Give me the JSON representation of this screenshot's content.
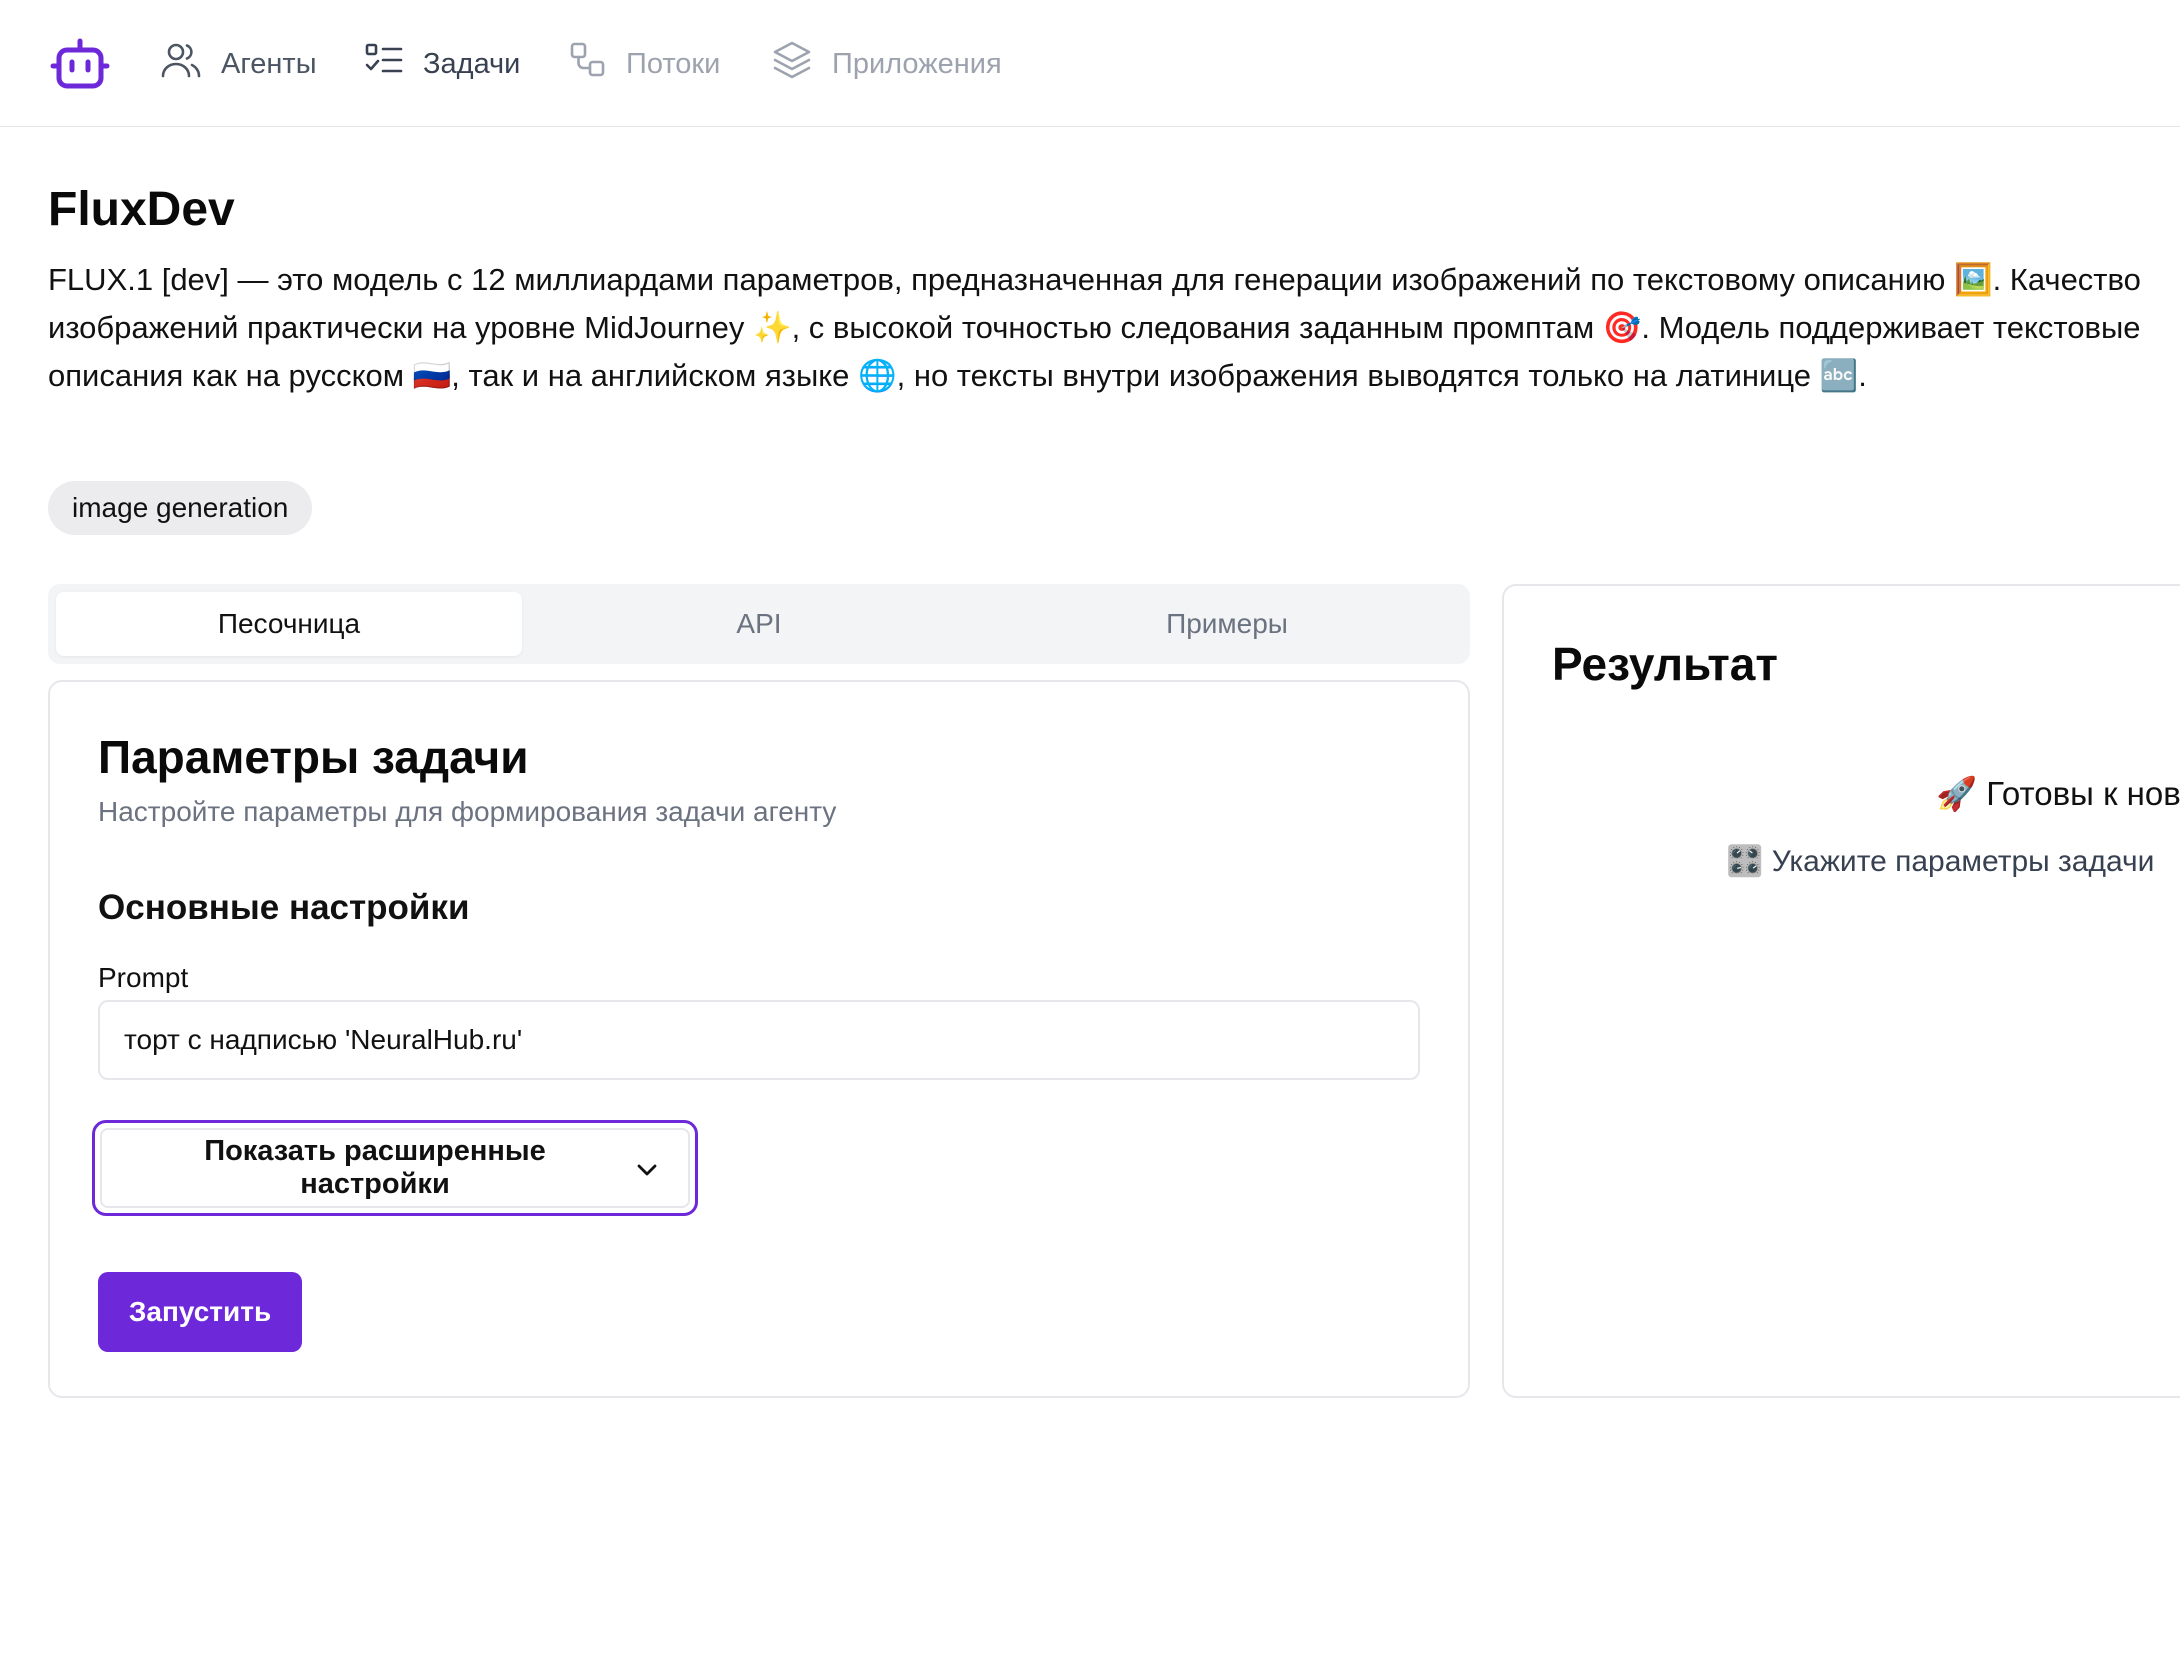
{
  "nav": {
    "logo_icon": "robot-icon",
    "items": [
      {
        "label": "Агенты",
        "icon": "users-icon"
      },
      {
        "label": "Задачи",
        "icon": "tasks-list-icon"
      },
      {
        "label": "Потоки",
        "icon": "flows-icon"
      },
      {
        "label": "Приложения",
        "icon": "layers-icon"
      }
    ]
  },
  "agent": {
    "title": "FluxDev",
    "description": "FLUX.1 [dev] — это модель с 12 миллиардами параметров, предназначенная для генерации изображений по текстовому описанию 🖼️. Качество изображений практически на уровне MidJourney ✨, с высокой точностью следования заданным промптам 🎯. Модель поддерживает текстовые описания как на русском 🇷🇺, так и на английском языке 🌐, но тексты внутри изображения выводятся только на латинице 🔤.",
    "tag": "image generation"
  },
  "tabs": [
    {
      "label": "Песочница",
      "active": true
    },
    {
      "label": "API",
      "active": false
    },
    {
      "label": "Примеры",
      "active": false
    }
  ],
  "params": {
    "title": "Параметры задачи",
    "subtitle": "Настройте параметры для формирования задачи агенту",
    "section_title": "Основные настройки",
    "prompt_label": "Prompt",
    "prompt_value": "торт с надписью 'NeuralHub.ru'",
    "advanced_label": "Показать расширенные настройки",
    "run_label": "Запустить"
  },
  "result": {
    "title": "Результат",
    "ready_text": "🚀 Готовы к нов",
    "hint_text": "🎛️ Укажите параметры задачи"
  },
  "colors": {
    "accent": "#6d28d9",
    "border": "#e5e7eb",
    "muted_text": "#6b7280",
    "tab_bg": "#f3f4f6",
    "tag_bg": "#ececee"
  }
}
